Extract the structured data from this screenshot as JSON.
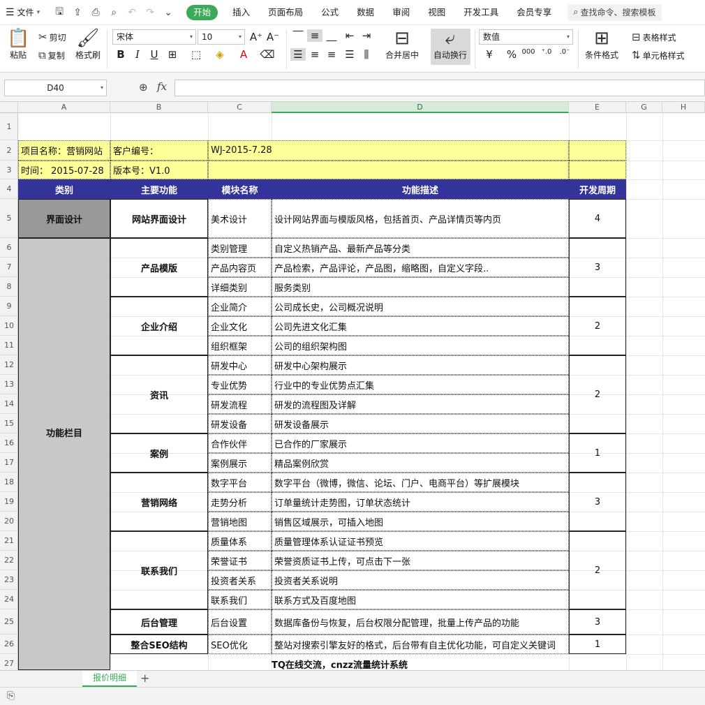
{
  "menubar": {
    "file": "文件",
    "tabs": [
      "开始",
      "插入",
      "页面布局",
      "公式",
      "数据",
      "审阅",
      "视图",
      "开发工具",
      "会员专享"
    ],
    "search": "查找命令、搜索模板"
  },
  "ribbon": {
    "paste": "粘贴",
    "cut": "剪切",
    "copy": "复制",
    "format_painter": "格式刷",
    "font_name": "宋体",
    "font_size": "10",
    "merge_center": "合并居中",
    "auto_wrap": "自动换行",
    "number_format": "数值",
    "cond_format": "条件格式",
    "table_style": "表格样式",
    "cell_style": "单元格样式"
  },
  "formula": {
    "cell_ref": "D40",
    "content": ""
  },
  "columns": [
    "A",
    "B",
    "C",
    "D",
    "E",
    "G",
    "H"
  ],
  "sheet": {
    "r2": {
      "project": "项目名称：营销网站",
      "client_label": "客户编号：",
      "client_no": "WJ-2015-7.28"
    },
    "r3": {
      "time": "时间： 2015-07-28",
      "version": "版本号：V1.0"
    },
    "header": [
      "类别",
      "主要功能",
      "模块名称",
      "功能描述",
      "开发周期"
    ],
    "cat_ui": "界面设计",
    "cat_func": "功能栏目",
    "r5": {
      "main": "网站界面设计",
      "module": "美术设计",
      "desc": "设计网站界面与模版风格，包括首页、产品详情页等内页",
      "cycle": "4"
    },
    "groups": [
      {
        "main": "产品模版",
        "cycle": "3"
      },
      {
        "main": "企业介绍",
        "cycle": "2"
      },
      {
        "main": "资讯",
        "cycle": "2"
      },
      {
        "main": "案例",
        "cycle": "1"
      },
      {
        "main": "营销网络",
        "cycle": "3"
      },
      {
        "main": "联系我们",
        "cycle": "2"
      },
      {
        "main": "后台管理",
        "cycle": "3"
      },
      {
        "main": "整合SEO结构",
        "cycle": "1"
      }
    ],
    "rows": [
      {
        "module": "类别管理",
        "desc": "自定义热销产品、最新产品等分类"
      },
      {
        "module": "产品内容页",
        "desc": "产品检索，产品评论，产品图，缩略图，自定义字段.."
      },
      {
        "module": "详细类别",
        "desc": "服务类别"
      },
      {
        "module": "企业简介",
        "desc": "公司成长史，公司概况说明"
      },
      {
        "module": "企业文化",
        "desc": "公司先进文化汇集"
      },
      {
        "module": "组织框架",
        "desc": "公司的组织架构图"
      },
      {
        "module": "研发中心",
        "desc": "研发中心架构展示"
      },
      {
        "module": "专业优势",
        "desc": "行业中的专业优势点汇集"
      },
      {
        "module": "研发流程",
        "desc": "研发的流程图及详解"
      },
      {
        "module": "研发设备",
        "desc": "研发设备展示"
      },
      {
        "module": "合作伙伴",
        "desc": "已合作的厂家展示"
      },
      {
        "module": "案例展示",
        "desc": "精品案例欣赏"
      },
      {
        "module": "数字平台",
        "desc": "数字平台（微博，微信、论坛、门户、电商平台）等扩展模块"
      },
      {
        "module": "走势分析",
        "desc": "订单量统计走势图，订单状态统计"
      },
      {
        "module": "营销地图",
        "desc": "销售区域展示，可插入地图"
      },
      {
        "module": "质量体系",
        "desc": "质量管理体系认证证书预览"
      },
      {
        "module": "荣誉证书",
        "desc": "荣誉资质证书上传，可点击下一张"
      },
      {
        "module": "投资者关系",
        "desc": "投资者关系说明"
      },
      {
        "module": "联系我们",
        "desc": "联系方式及百度地图"
      },
      {
        "module": "后台设置",
        "desc": "数据库备份与恢复，后台权限分配管理，批量上传产品的功能"
      },
      {
        "module": "SEO优化",
        "desc": "整站对搜索引擎友好的格式，后台带有自主优化功能，可自定义关键词"
      }
    ],
    "r27": "TQ在线交流，cnzz流量统计系统"
  },
  "sheet_tab": "报价明细"
}
